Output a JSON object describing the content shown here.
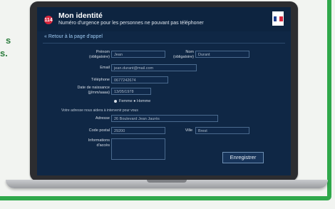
{
  "side_text": [
    "s",
    "s."
  ],
  "header": {
    "badge": "114",
    "title": "Mon identité",
    "subtitle": "Numéro d'urgence pour les personnes ne pouvant pas téléphoner"
  },
  "nav": {
    "back_link": "« Retour à la page d'appel"
  },
  "form": {
    "prenom_label": "Prénom (obligatoire)",
    "prenom_value": "Jean",
    "nom_label": "Nom (obligatoire)",
    "nom_value": "Durant",
    "email_label": "Email",
    "email_value": "jean.durant@mail.com",
    "telephone_label": "Téléphone",
    "telephone_value": "0677242674",
    "naissance_label": "Date de naissance (jj/mm/aaaa)",
    "naissance_value": "13/05/1978",
    "radio_label": "Femme  ● Homme",
    "address_note": "Votre adresse nous aidera à intervenir pour vous",
    "adresse_label": "Adresse",
    "adresse_value": "26 Boulevard Jean Jaurès",
    "code_postal_label": "Code postal",
    "code_postal_value": "29200",
    "ville_label": "Ville",
    "ville_value": "Brest",
    "infos_label": "Informations d'accès",
    "save_button": "Enregistrer"
  },
  "colors": {
    "screen_bg": "#0f2745",
    "accent_green": "#2fa84b",
    "badge_red": "#d7263d"
  }
}
